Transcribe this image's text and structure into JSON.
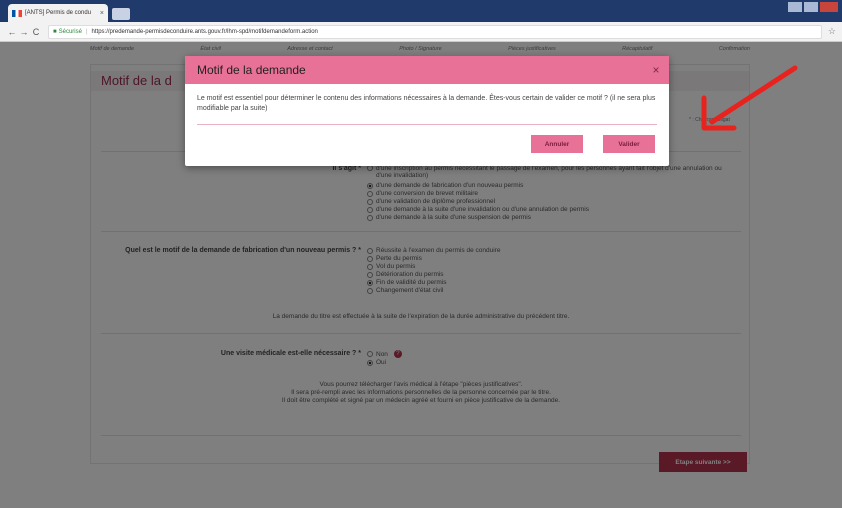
{
  "browser": {
    "tab_title": "[ANTS] Permis de condu",
    "secure_label": "Sécurisé",
    "url": "https://predemande-permisdeconduire.ants.gouv.fr/lhm-spd/motifdemandeform.action"
  },
  "steps": [
    "Motif de demande",
    "État civil",
    "Adresse et contact",
    "Photo / Signature",
    "Pièces justificatives",
    "Récapitulatif",
    "Confirmation"
  ],
  "page": {
    "title": "Motif de la d",
    "required_note": "* : Champs obligat",
    "q1_label": "Il s'agit *",
    "q1_options": [
      {
        "text": "d'une inscription au permis nécessitant le passage de l'examen, pour les personnes ayant fait l'objet d'une annulation ou d'une invalidation)",
        "checked": false
      },
      {
        "text": "d'une demande de fabrication d'un nouveau permis",
        "checked": true
      },
      {
        "text": "d'une conversion de brevet militaire",
        "checked": false
      },
      {
        "text": "d'une validation de diplôme professionnel",
        "checked": false
      },
      {
        "text": "d'une demande à la suite d'une invalidation ou d'une annulation de permis",
        "checked": false
      },
      {
        "text": "d'une demande à la suite d'une suspension de permis",
        "checked": false
      }
    ],
    "q2_label": "Quel est le motif de la demande de fabrication d'un nouveau permis ? *",
    "q2_options": [
      {
        "text": "Réussite à l'examen du permis de conduire",
        "checked": false
      },
      {
        "text": "Perte du permis",
        "checked": false
      },
      {
        "text": "Vol du permis",
        "checked": false
      },
      {
        "text": "Détérioration du permis",
        "checked": false
      },
      {
        "text": "Fin de validité du permis",
        "checked": true
      },
      {
        "text": "Changement d'état civil",
        "checked": false
      }
    ],
    "q2_info": "La demande du titre est effectuée à la suite de l'expiration de la durée administrative du précédent titre.",
    "q3_label": "Une visite médicale est-elle nécessaire ? *",
    "q3_options": [
      {
        "text": "Non",
        "checked": false
      },
      {
        "text": "Oui",
        "checked": true
      }
    ],
    "q3_info_1": "Vous pourrez télécharger l'avis médical à l'étape \"pièces justificatives\".",
    "q3_info_2": "Il sera pré-rempli avec les informations personnelles de la personne concernée par le titre.",
    "q3_info_3": "Il doit être complété et signé par un médecin agréé et fourni en pièce justificative de la demande.",
    "next_label": "Etape suivante  >>"
  },
  "modal": {
    "title": "Motif de la demande",
    "close_glyph": "×",
    "body": "Le motif est essentiel pour déterminer le contenu des informations nécessaires à la demande. Êtes-vous certain de valider ce motif ? (il ne sera plus modifiable par la suite)",
    "cancel_label": "Annuler",
    "confirm_label": "Valider"
  },
  "colors": {
    "accent": "#e87297",
    "brand": "#b4334d",
    "annotation_arrow": "#e8231e"
  }
}
